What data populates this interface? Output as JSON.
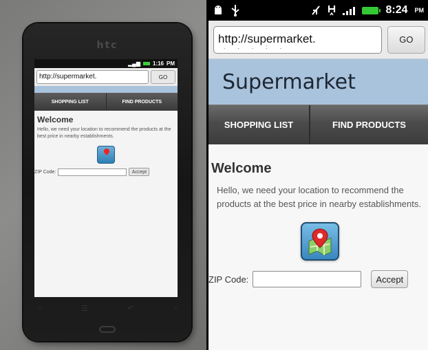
{
  "photo": {
    "brand": "htc",
    "status_time": "1:16",
    "status_ampm": "PM",
    "url": "http://supermarket.",
    "go_label": "GO",
    "nav": [
      "SHOPPING LIST",
      "FIND PRODUCTS"
    ],
    "welcome": "Welcome",
    "intro": "Hello, we need your location to recommend the products at the best price in nearby establishments.",
    "zip_label": "ZIP Code:",
    "accept_label": "Accept"
  },
  "status_bar": {
    "time": "8:24",
    "ampm": "PM",
    "colors": {
      "battery": "#35c935",
      "background": "#000000"
    }
  },
  "browser": {
    "url": "http://supermarket.",
    "go_label": "GO"
  },
  "site": {
    "title": "Supermarket",
    "header_color": "#a9c3dc",
    "nav": {
      "shopping_list": "SHOPPING LIST",
      "find_products": "FIND PRODUCTS"
    },
    "welcome": "Welcome",
    "intro": "Hello, we need your location to recommend the products at the best price in nearby establishments.",
    "location_icon": "map-pin-icon",
    "zip_label": "ZIP Code:",
    "zip_value": "",
    "accept_label": "Accept"
  }
}
